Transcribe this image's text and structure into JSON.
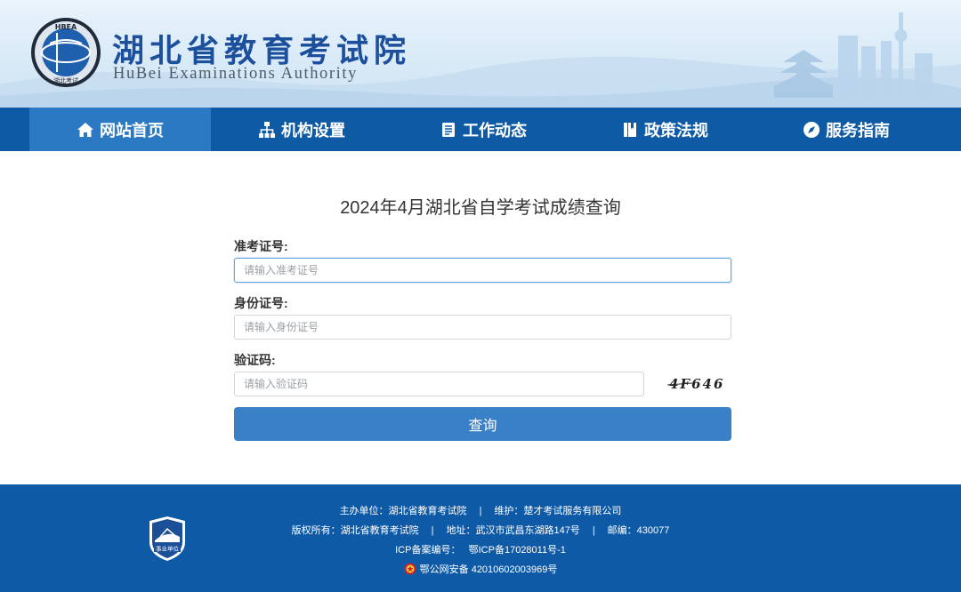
{
  "header": {
    "emblem_text": "HBEA",
    "emblem_sub": "湖北考试",
    "title_cn": "湖北省教育考试院",
    "title_en": "HuBei Examinations Authority"
  },
  "nav": {
    "items": [
      {
        "label": "网站首页",
        "icon": "home-icon"
      },
      {
        "label": "机构设置",
        "icon": "sitemap-icon"
      },
      {
        "label": "工作动态",
        "icon": "news-icon"
      },
      {
        "label": "政策法规",
        "icon": "book-icon"
      },
      {
        "label": "服务指南",
        "icon": "compass-icon"
      }
    ],
    "active_index": 0
  },
  "form": {
    "title": "2024年4月湖北省自学考试成绩查询",
    "ticket_label": "准考证号:",
    "ticket_placeholder": "请输入准考证号",
    "ticket_value": "",
    "id_label": "身份证号:",
    "id_placeholder": "请输入身份证号",
    "id_value": "",
    "captcha_label": "验证码:",
    "captcha_placeholder": "请输入验证码",
    "captcha_value": "",
    "captcha_text": "4F646",
    "submit_label": "查询"
  },
  "footer": {
    "badge_text": "事业单位",
    "sponsor": "主办单位：湖北省教育考试院",
    "maintainer": "维护：楚才考试服务有限公司",
    "copyright": "版权所有：湖北省教育考试院",
    "address": "地址：武汉市武昌东湖路147号",
    "postcode": "邮编：430077",
    "icp": "ICP备案编号：   鄂ICP备17028011号-1",
    "police": "鄂公网安备 42010602003969号",
    "divider": "|"
  },
  "colors": {
    "brand_blue": "#0e5aa5",
    "nav_active": "#2b78c3",
    "button_blue": "#3a80c6",
    "footer_blue": "#0f5aa6"
  }
}
